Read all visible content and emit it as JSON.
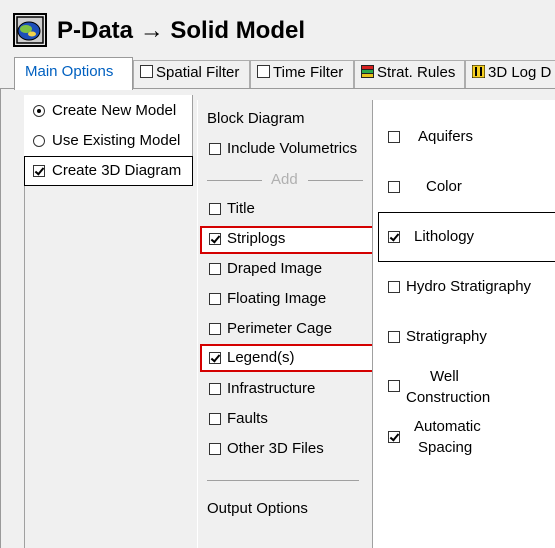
{
  "window": {
    "title": "P-Data → Solid Model"
  },
  "tabs": [
    {
      "label": "Main Options",
      "active": true
    },
    {
      "label": "Spatial Filter",
      "icon": "checkbox-icon"
    },
    {
      "label": "Time Filter",
      "icon": "checkbox-icon"
    },
    {
      "label": "Strat. Rules",
      "icon": "strat-rules-icon"
    },
    {
      "label": "3D Log D",
      "icon": "3d-log-icon"
    }
  ],
  "model_source": {
    "create_new": {
      "label": "Create New Model",
      "selected": true
    },
    "use_existing": {
      "label": "Use Existing Model",
      "selected": false
    }
  },
  "create_3d_diagram": {
    "label": "Create 3D Diagram",
    "checked": true
  },
  "block_diagram": {
    "heading": "Block Diagram",
    "include_volumetrics": {
      "label": "Include Volumetrics",
      "checked": false
    },
    "add_separator_label": "Add",
    "items": [
      {
        "label": "Title",
        "checked": false
      },
      {
        "label": "Striplogs",
        "checked": true,
        "highlighted": true
      },
      {
        "label": "Draped Image",
        "checked": false
      },
      {
        "label": "Floating Image",
        "checked": false
      },
      {
        "label": "Perimeter Cage",
        "checked": false
      },
      {
        "label": "Legend(s)",
        "checked": true,
        "highlighted": true
      },
      {
        "label": "Infrastructure",
        "checked": false
      },
      {
        "label": "Faults",
        "checked": false
      },
      {
        "label": "Other 3D Files",
        "checked": false
      }
    ],
    "output_options_label": "Output Options"
  },
  "striplog_options": [
    {
      "label": "Aquifers",
      "checked": false
    },
    {
      "label": "Color",
      "checked": false
    },
    {
      "label": "Lithology",
      "checked": true
    },
    {
      "label": "Hydro Stratigraphy",
      "checked": false
    },
    {
      "label": "Stratigraphy",
      "checked": false
    },
    {
      "label": "Well Construction",
      "line1": "Well",
      "line2": "Construction",
      "checked": false
    },
    {
      "label": "Automatic Spacing",
      "line1": "Automatic",
      "line2": "Spacing",
      "checked": true
    }
  ],
  "colors": {
    "active_tab_text": "#0060c0",
    "highlight_border": "#d40000",
    "panel_background": "#f0f0f0"
  }
}
